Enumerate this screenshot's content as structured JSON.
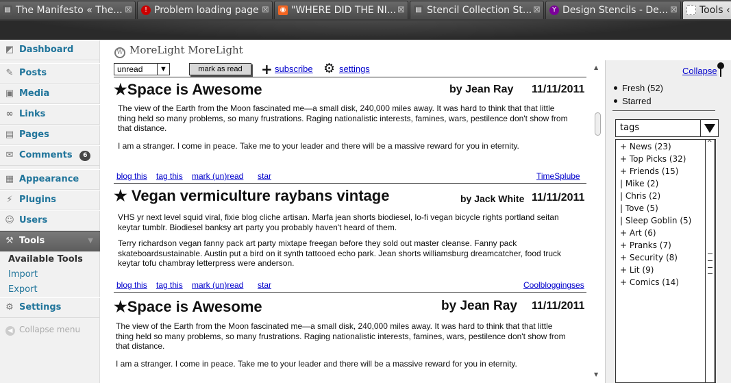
{
  "browser": {
    "tabs": [
      {
        "title": "The Manifesto « The...",
        "icon": "page-icon",
        "icon_color": "#555555"
      },
      {
        "title": "Problem loading page",
        "icon": "error-icon",
        "icon_color": "#cc0000"
      },
      {
        "title": "\"WHERE DID THE NI...",
        "icon": "rss-icon",
        "icon_color": "#f26522"
      },
      {
        "title": "Stencil Collection St...",
        "icon": "page-icon",
        "icon_color": "#555555"
      },
      {
        "title": "Design Stencils - De...",
        "icon": "yahoo-icon",
        "icon_color": "#7b0099"
      },
      {
        "title": "Tools ‹",
        "icon": "page-icon",
        "icon_color": "#888888"
      }
    ],
    "close_glyph": "⊠"
  },
  "admin_menu": {
    "items": [
      {
        "label": "Dashboard",
        "icon": "dashboard-icon"
      },
      {
        "label": "Posts",
        "icon": "pin-icon"
      },
      {
        "label": "Media",
        "icon": "media-icon"
      },
      {
        "label": "Links",
        "icon": "link-icon"
      },
      {
        "label": "Pages",
        "icon": "pages-icon"
      },
      {
        "label": "Comments",
        "icon": "comments-icon",
        "badge": "6"
      },
      {
        "label": "Appearance",
        "icon": "appearance-icon"
      },
      {
        "label": "Plugins",
        "icon": "plugins-icon"
      },
      {
        "label": "Users",
        "icon": "users-icon"
      },
      {
        "label": "Tools",
        "icon": "tools-icon",
        "current": true
      },
      {
        "label": "Settings",
        "icon": "settings-icon"
      }
    ],
    "tools_submenu": [
      "Available Tools",
      "Import",
      "Export"
    ],
    "collapse_label": "Collapse menu"
  },
  "site": {
    "title": "MoreLight MoreLight"
  },
  "toolbar": {
    "filter_value": "unread",
    "mark_read_label": "mark as read",
    "subscribe_label": "subscribe",
    "settings_label": "settings"
  },
  "articles": [
    {
      "star": "★",
      "title": "Space is Awesome",
      "author": "by Jean Ray",
      "date": "11/11/2011",
      "paragraphs": [
        "The view of the Earth from the Moon fascinated me—a small disk, 240,000 miles away. It was hard to think that that little thing held so many problems, so many frustrations. Raging nationalistic interests, famines, wars, pestilence don't show from that distance.",
        "I am a stranger. I come in peace. Take me to your leader and there will be a massive reward for you in eternity."
      ],
      "actions": {
        "blog": "blog this",
        "tag": "tag this",
        "mark": "mark (un)read",
        "star": "star"
      },
      "source": "TimeSplube"
    },
    {
      "star": "★",
      "title": "Vegan vermiculture raybans vintage",
      "author": "by Jack White",
      "date": "11/11/2011",
      "paragraphs": [
        "VHS yr next level squid viral, fixie blog cliche artisan. Marfa jean shorts biodiesel, lo-fi vegan bicycle rights portland seitan keytar tumblr. Biodiesel  banksy art party you probably haven't heard of them.",
        "Terry richardson vegan fanny pack art party mixtape freegan before they sold out master cleanse. Fanny pack skateboardsustainable. Austin put a bird on it synth tattooed echo park. Jean shorts williamsburg dreamcatcher, food truck keytar tofu chambray letterpress were anderson."
      ],
      "actions": {
        "blog": "blog this",
        "tag": "tag this",
        "mark": "mark (un)read",
        "star": "star"
      },
      "source": "Coolbloggingses"
    },
    {
      "star": "★",
      "title": "Space is Awesome",
      "author": "by Jean Ray",
      "date": "11/11/2011",
      "paragraphs": [
        "The view of the Earth from the Moon fascinated me—a small disk, 240,000 miles away. It was hard to think that that little thing held so many problems, so many frustrations. Raging nationalistic interests, famines, wars, pestilence don't show from that distance.",
        "I am a stranger. I come in peace. Take me to your leader and there will be a massive reward for you in eternity."
      ]
    }
  ],
  "side_panel": {
    "collapse_label": "Collapse",
    "feeds": [
      "Fresh (52)",
      "Starred"
    ],
    "tags_select_value": "tags",
    "tags": [
      "+ News (23)",
      "+ Top Picks (32)",
      "+ Friends (15)",
      "| Mike (2)",
      "| Chris (2)",
      "| Tove (5)",
      "| Sleep Goblin (5)",
      "+ Art (6)",
      "+ Pranks (7)",
      "+ Security (8)",
      "+ Lit (9)",
      "+ Comics (14)"
    ]
  },
  "colors": {
    "link": "#0000cc",
    "admin_link": "#21759b",
    "current_menu": "#6a6a6a"
  }
}
